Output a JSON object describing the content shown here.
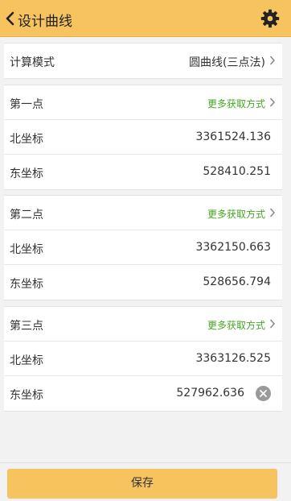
{
  "header": {
    "title": "设计曲线",
    "icons": {
      "back": "chevron-left-icon",
      "settings": "gear-icon"
    }
  },
  "mode": {
    "label": "计算模式",
    "value": "圆曲线(三点法)"
  },
  "points": [
    {
      "title": "第一点",
      "link": "更多获取方式",
      "north_label": "北坐标",
      "north": "3361524.136",
      "east_label": "东坐标",
      "east": "528410.251"
    },
    {
      "title": "第二点",
      "link": "更多获取方式",
      "north_label": "北坐标",
      "north": "3362150.663",
      "east_label": "东坐标",
      "east": "528656.794"
    },
    {
      "title": "第三点",
      "link": "更多获取方式",
      "north_label": "北坐标",
      "north": "3363126.525",
      "east_label": "东坐标",
      "east": "527962.636"
    }
  ],
  "save_label": "保存",
  "colors": {
    "header": "#f6c35f",
    "link": "#45a820",
    "background": "#f2f2f2"
  }
}
